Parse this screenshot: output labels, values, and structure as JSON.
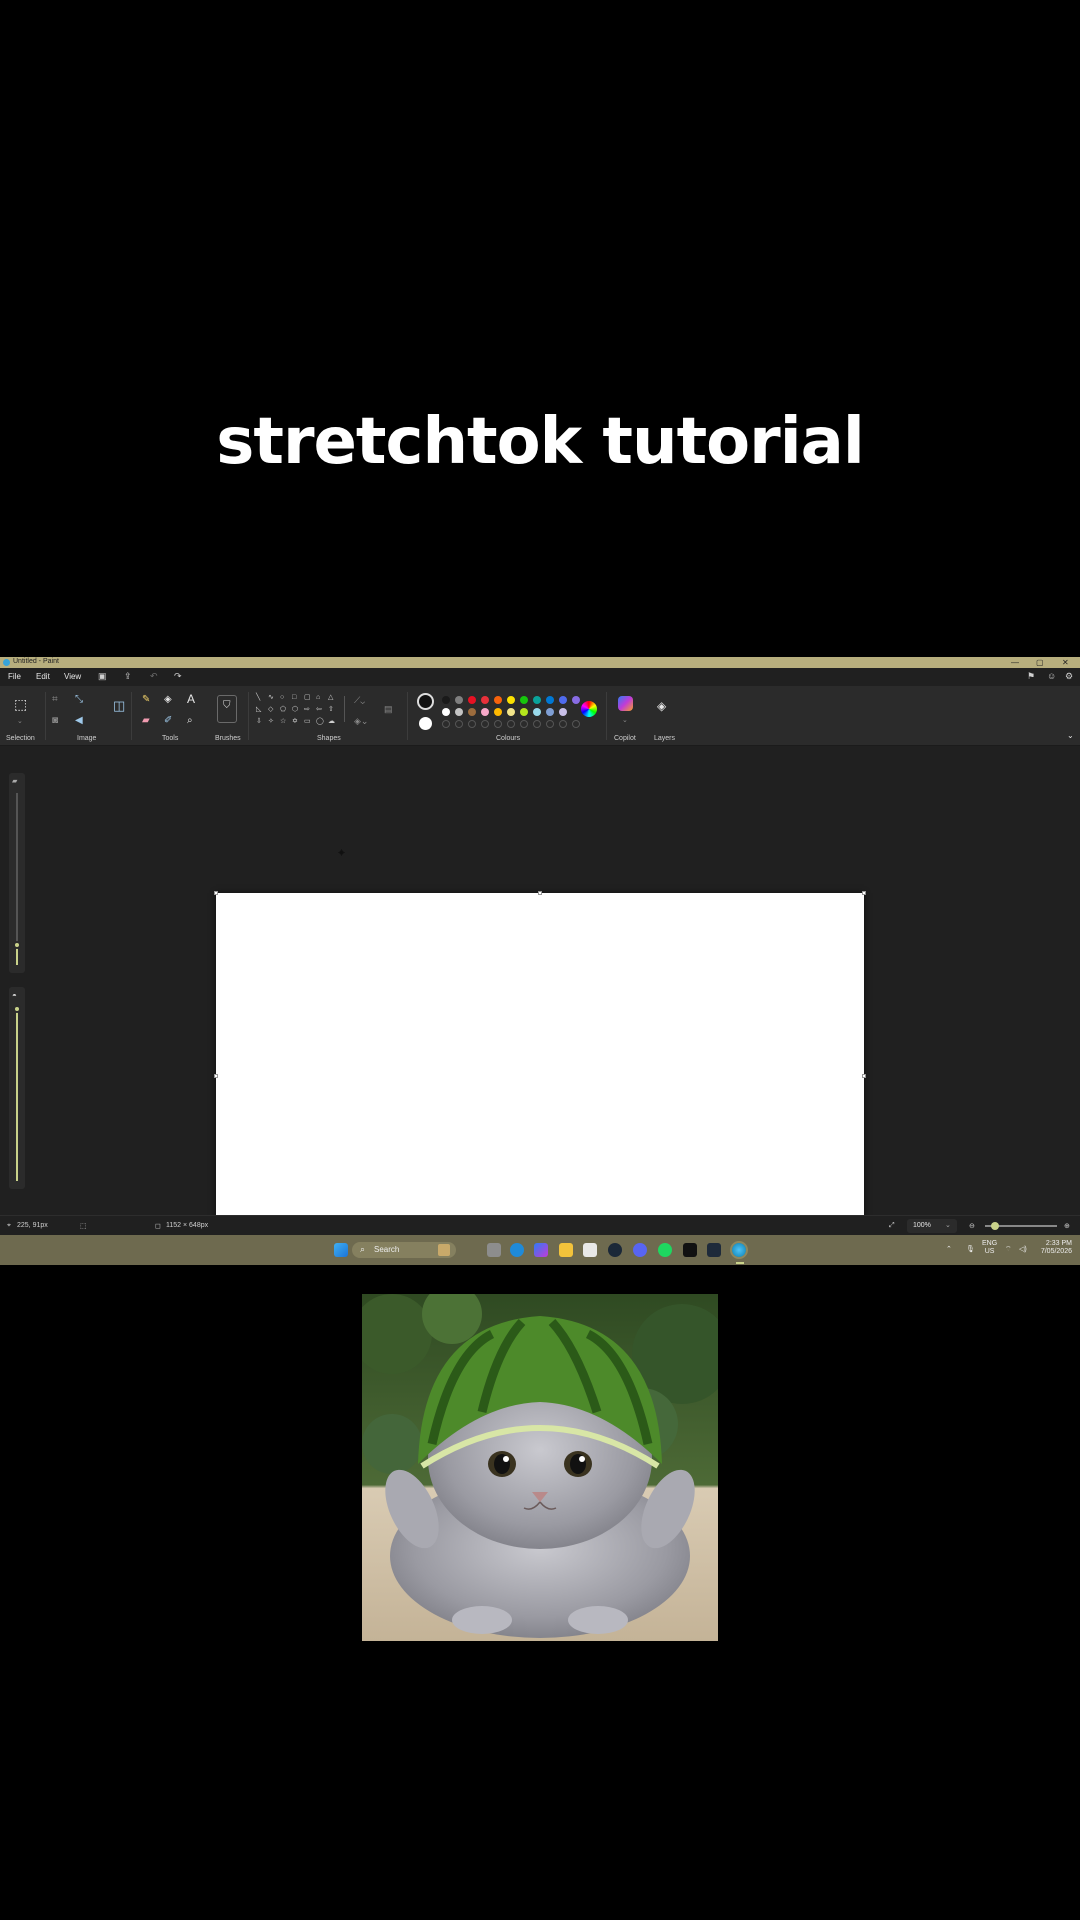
{
  "headline": "stretchtok tutorial",
  "window": {
    "title": "Untitled - Paint",
    "controls": [
      "—",
      "▢",
      "✕"
    ]
  },
  "menubar": {
    "items": [
      "File",
      "Edit",
      "View"
    ]
  },
  "ribbon": {
    "groups": [
      "Selection",
      "Image",
      "Tools",
      "Brushes",
      "Shapes",
      "Colours",
      "Copilot",
      "Layers"
    ]
  },
  "colors": {
    "accent": "#c9d28a",
    "titlebar": "#b7ae7d",
    "taskbar": "#6e6a4f",
    "row1": [
      "#1a1a1a",
      "#7f7f7f",
      "#e81123",
      "#e8303a",
      "#f7630c",
      "#fce100",
      "#16c60c",
      "#0aa39a",
      "#0078d4",
      "#4f6bed",
      "#886ce4"
    ],
    "row2": [
      "#ffffff",
      "#c3c3c3",
      "#9c6c3d",
      "#f7a8c8",
      "#ffb900",
      "#f3e58a",
      "#b5e61d",
      "#99d9ea",
      "#7f9fd4",
      "#c8bfe7"
    ]
  },
  "statusbar": {
    "cursor_position": "225, 91px",
    "canvas_size": "1152 × 648px",
    "zoom": "100%"
  },
  "taskbar": {
    "search_label": "Search",
    "language": "ENG",
    "region": "US",
    "time": "2:33 PM",
    "date": "7/05/2026"
  }
}
